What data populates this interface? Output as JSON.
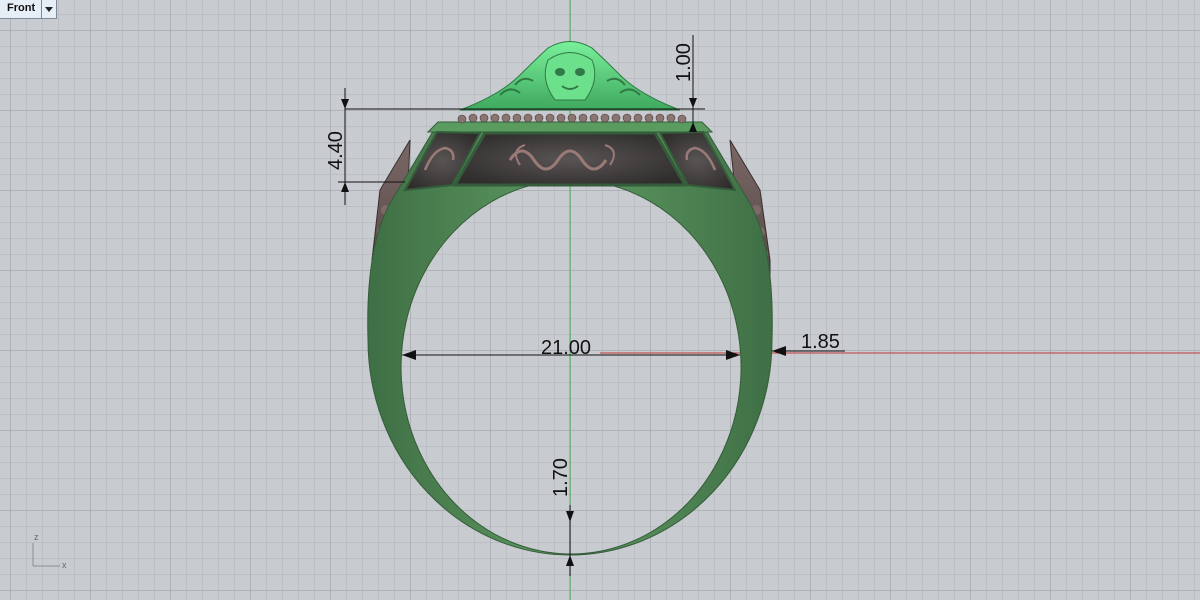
{
  "viewport": {
    "name": "Front"
  },
  "dimensions": {
    "top_height": "1.00",
    "head_height": "4.40",
    "inner_diameter": "21.00",
    "side_thickness": "1.85",
    "bottom_thickness": "1.70"
  },
  "axis_labels": {
    "z": "z",
    "x": "x"
  },
  "colors": {
    "shank": "#4f8a56",
    "head_top": "#5fcf7a",
    "metal": "#6b5a58",
    "x_axis": "#c0393b",
    "z_axis": "#3fbf4f"
  }
}
